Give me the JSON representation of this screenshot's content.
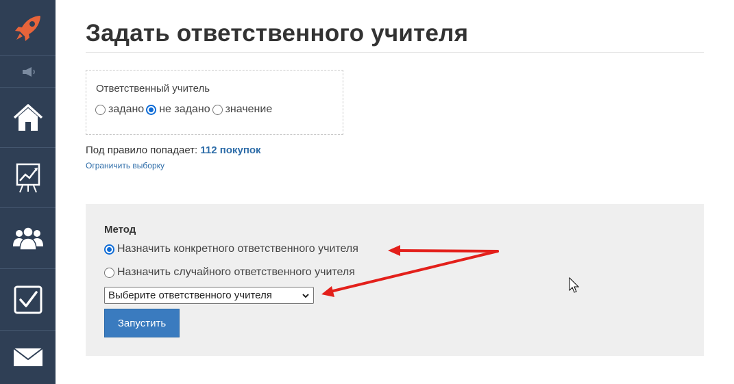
{
  "sidebar": {
    "items": [
      {
        "icon": "rocket-icon"
      },
      {
        "icon": "megaphone-icon"
      },
      {
        "icon": "home-icon"
      },
      {
        "icon": "chart-icon"
      },
      {
        "icon": "users-icon"
      },
      {
        "icon": "checkbox-icon"
      },
      {
        "icon": "mail-icon"
      }
    ],
    "colors": {
      "background": "#2f3f55",
      "logo": "#e8643a",
      "icon": "#ffffff",
      "muted": "#7b8ba0"
    }
  },
  "page": {
    "title": "Задать ответственного учителя"
  },
  "filter": {
    "label": "Ответственный учитель",
    "options": [
      {
        "label": "задано",
        "checked": false
      },
      {
        "label": "не задано",
        "checked": true
      },
      {
        "label": "значение",
        "checked": false
      }
    ]
  },
  "rule": {
    "prefix": "Под правило попадает:",
    "count": "112 покупок",
    "limit_link": "Ограничить выборку"
  },
  "method": {
    "title": "Метод",
    "options": [
      {
        "label": "Назначить конкретного ответственного учителя",
        "checked": true
      },
      {
        "label": "Назначить случайного ответственного учителя",
        "checked": false
      }
    ],
    "select_value": "Выберите ответственного учителя",
    "run_label": "Запустить"
  },
  "colors": {
    "accent": "#2d6ca8",
    "button": "#3a7bbf",
    "radio_checked": "#0f6cd6",
    "annotation_arrow": "#e3201b",
    "panel": "#efefef"
  }
}
